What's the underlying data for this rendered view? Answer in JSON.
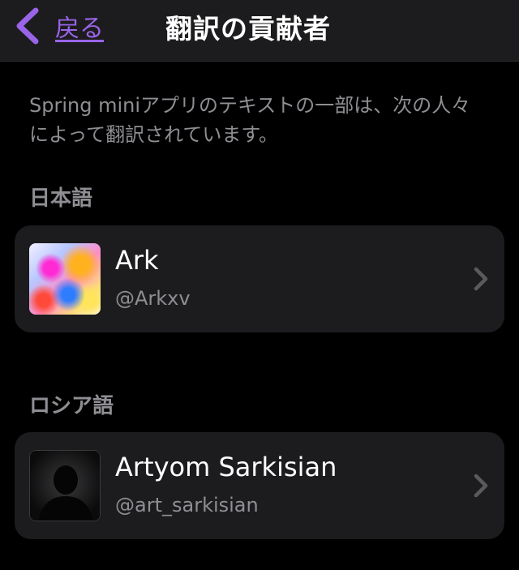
{
  "nav": {
    "back_label": "戻る",
    "title": "翻訳の貢献者"
  },
  "intro_text": "Spring miniアプリのテキストの一部は、次の人々によって翻訳されています。",
  "colors": {
    "accent": "#9a64e8",
    "background": "#000000",
    "card": "#1c1c1e",
    "secondary_text": "#8e8e93"
  },
  "sections": [
    {
      "header": "日本語",
      "contributor": {
        "name": "Ark",
        "handle": "@Arkxv",
        "avatar": "colorful-artwork-avatar"
      }
    },
    {
      "header": "ロシア語",
      "contributor": {
        "name": "Artyom Sarkisian",
        "handle": "@art_sarkisian",
        "avatar": "dark-silhouette-avatar"
      }
    }
  ]
}
